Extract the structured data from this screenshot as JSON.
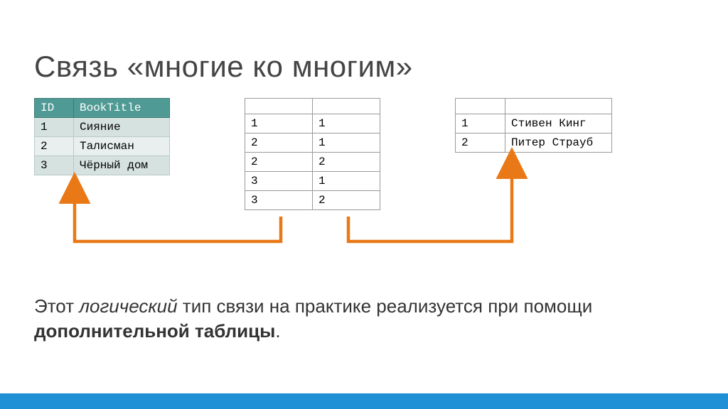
{
  "title": "Связь «многие ко многим»",
  "tables": {
    "left": {
      "headers": [
        "ID",
        "BookTitle"
      ],
      "rows": [
        [
          "1",
          "Сияние"
        ],
        [
          "2",
          "Талисман"
        ],
        [
          "3",
          "Чёрный дом"
        ]
      ]
    },
    "middle": {
      "rows": [
        [
          "1",
          "1"
        ],
        [
          "2",
          "1"
        ],
        [
          "2",
          "2"
        ],
        [
          "3",
          "1"
        ],
        [
          "3",
          "2"
        ]
      ]
    },
    "right": {
      "rows": [
        [
          "1",
          "Стивен Кинг"
        ],
        [
          "2",
          "Питер Страуб"
        ]
      ]
    }
  },
  "description": {
    "prefix": "Этот ",
    "italic": "логический",
    "middle": " тип связи на практике реализуется при помощи ",
    "bold": "дополнительной таблицы",
    "suffix": "."
  }
}
